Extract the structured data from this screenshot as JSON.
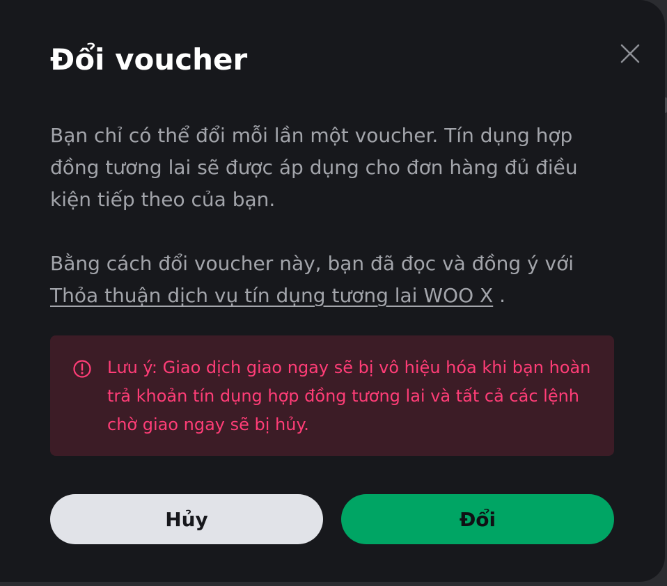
{
  "dialog": {
    "title": "Đổi voucher",
    "close_icon": "close-icon",
    "description": "Bạn chỉ có thể đổi mỗi lần một voucher. Tín dụng hợp đồng tương lai sẽ được áp dụng cho đơn hàng đủ điều kiện tiếp theo của bạn.",
    "agreement_prefix": "Bằng cách đổi voucher này, bạn đã đọc và đồng ý với",
    "agreement_link": "Thỏa thuận dịch vụ tín dụng tương lai WOO X",
    "agreement_suffix": ".",
    "warning": {
      "icon": "alert-circle-icon",
      "text": "Lưu ý: Giao dịch giao ngay sẽ bị vô hiệu hóa khi bạn hoàn trả khoản tín dụng hợp đồng tương lai và tất cả các lệnh chờ giao ngay sẽ bị hủy."
    },
    "cancel_label": "Hủy",
    "confirm_label": "Đổi"
  },
  "colors": {
    "modal_bg": "#17181c",
    "title": "#ffffff",
    "body_text": "#a3a5ab",
    "warning_bg": "#3c1c26",
    "warning_text": "#ff3d77",
    "cancel_bg": "#e1e3e8",
    "confirm_bg": "#00a564"
  }
}
